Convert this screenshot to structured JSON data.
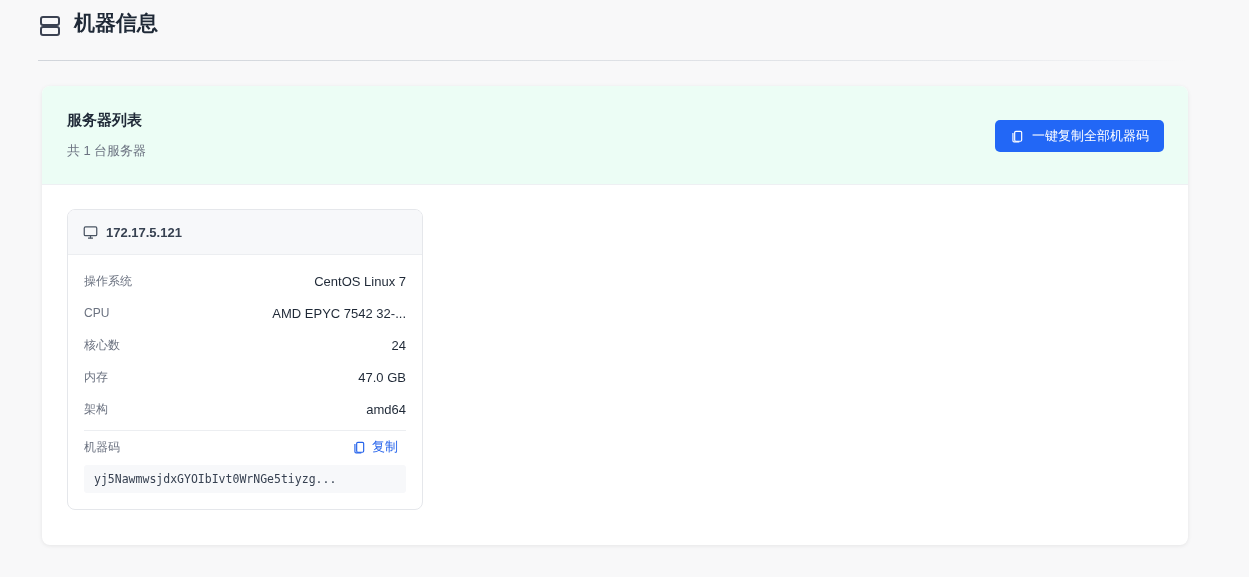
{
  "page": {
    "title": "机器信息"
  },
  "panel": {
    "title": "服务器列表",
    "subtitle": "共 1 台服务器",
    "copy_all_button": "一键复制全部机器码"
  },
  "servers": [
    {
      "ip": "172.17.5.121",
      "fields": [
        {
          "label": "操作系统",
          "value": "CentOS Linux 7"
        },
        {
          "label": "CPU",
          "value": "AMD EPYC 7542 32-..."
        },
        {
          "label": "核心数",
          "value": "24"
        },
        {
          "label": "内存",
          "value": "47.0 GB"
        },
        {
          "label": "架构",
          "value": "amd64"
        }
      ],
      "code_label": "机器码",
      "copy_button": "复制",
      "code": "yj5NawmwsjdxGYOIbIvt0WrNGe5tiyzg..."
    }
  ]
}
